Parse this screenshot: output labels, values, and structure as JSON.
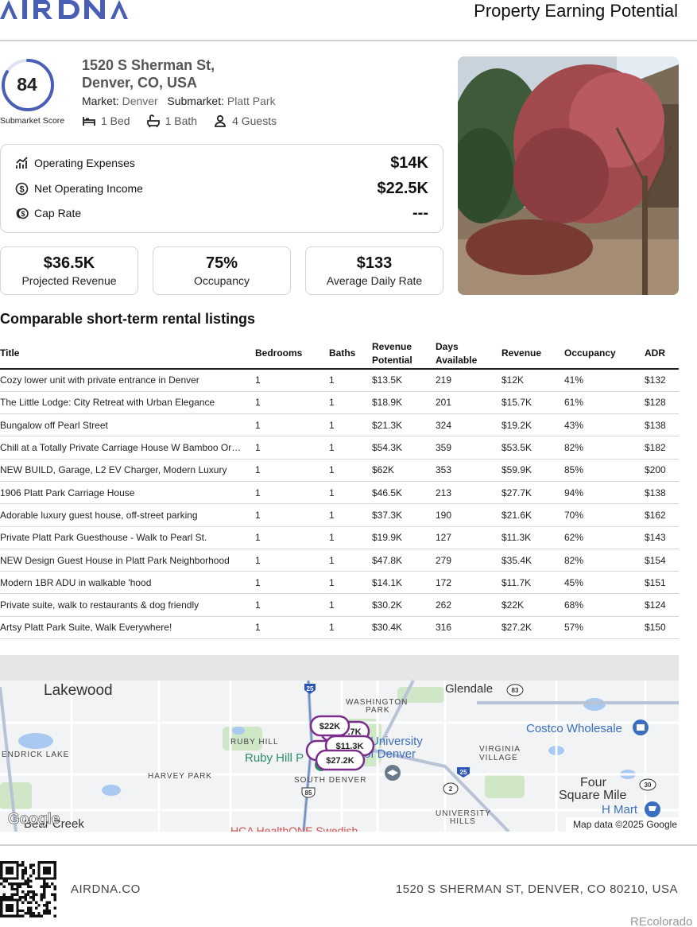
{
  "header": {
    "logo_text": "AIRDNA",
    "title": "Property Earning Potential"
  },
  "score": {
    "value": "84",
    "label": "Submarket Score",
    "fraction": 0.84,
    "color": "#4a5fb4"
  },
  "property": {
    "address_line1": "1520 S Sherman St,",
    "address_line2": "Denver, CO, USA",
    "market_label": "Market:",
    "market_value": "Denver",
    "submarket_label": "Submarket:",
    "submarket_value": "Platt Park",
    "beds": "1 Bed",
    "baths": "1 Bath",
    "guests": "4 Guests"
  },
  "operating": {
    "expenses_label": "Operating Expenses",
    "expenses_value": "$14K",
    "noi_label": "Net Operating Income",
    "noi_value": "$22.5K",
    "cap_label": "Cap Rate",
    "cap_value": "---"
  },
  "metrics": [
    {
      "value": "$36.5K",
      "label": "Projected Revenue"
    },
    {
      "value": "75%",
      "label": "Occupancy"
    },
    {
      "value": "$133",
      "label": "Average Daily Rate"
    }
  ],
  "comparables": {
    "heading": "Comparable short-term rental listings",
    "columns": {
      "title": "Title",
      "bedrooms": "Bedrooms",
      "baths": "Baths",
      "revenue_potential_1": "Revenue",
      "revenue_potential_2": "Potential",
      "days_available_1": "Days",
      "days_available_2": "Available",
      "revenue": "Revenue",
      "occupancy": "Occupancy",
      "adr": "ADR"
    },
    "rows": [
      [
        "Cozy lower unit with private entrance in Denver",
        "1",
        "1",
        "$13.5K",
        "219",
        "$12K",
        "41%",
        "$132"
      ],
      [
        "The Little Lodge: City Retreat with Urban Elegance",
        "1",
        "1",
        "$18.9K",
        "201",
        "$15.7K",
        "61%",
        "$128"
      ],
      [
        "Bungalow off Pearl Street",
        "1",
        "1",
        "$21.3K",
        "324",
        "$19.2K",
        "43%",
        "$138"
      ],
      [
        "Chill at a Totally Private Carriage House W Bamboo Or…",
        "1",
        "1",
        "$54.3K",
        "359",
        "$53.5K",
        "82%",
        "$182"
      ],
      [
        "NEW BUILD, Garage, L2 EV Charger, Modern Luxury",
        "1",
        "1",
        "$62K",
        "353",
        "$59.9K",
        "85%",
        "$200"
      ],
      [
        "1906 Platt Park Carriage House",
        "1",
        "1",
        "$46.5K",
        "213",
        "$27.7K",
        "94%",
        "$138"
      ],
      [
        "Adorable luxury guest house, off-street parking",
        "1",
        "1",
        "$37.3K",
        "190",
        "$21.6K",
        "70%",
        "$162"
      ],
      [
        "Private Platt Park Guesthouse - Walk to Pearl St.",
        "1",
        "1",
        "$19.9K",
        "127",
        "$11.3K",
        "62%",
        "$143"
      ],
      [
        "NEW Design Guest House in Platt Park Neighborhood",
        "1",
        "1",
        "$47.8K",
        "279",
        "$35.4K",
        "82%",
        "$154"
      ],
      [
        "Modern 1BR ADU in walkable 'hood",
        "1",
        "1",
        "$14.1K",
        "172",
        "$11.7K",
        "45%",
        "$151"
      ],
      [
        "Private suite, walk to restaurants & dog friendly",
        "1",
        "1",
        "$30.2K",
        "262",
        "$22K",
        "68%",
        "$124"
      ],
      [
        "Artsy Platt Park Suite, Walk Everywhere!",
        "1",
        "1",
        "$30.4K",
        "316",
        "$27.2K",
        "57%",
        "$150"
      ]
    ]
  },
  "map": {
    "labels": {
      "lakewood": "Lakewood",
      "glendale": "Glendale",
      "washington_park": "WASHINGTON",
      "washington_park2": "PARK",
      "ruby_hill": "RUBY HILL",
      "ruby_hill_park": "Ruby Hill P",
      "university": "University",
      "of_denver": "of Denver",
      "endrick_lake": "ENDRICK LAKE",
      "harvey_park": "HARVEY PARK",
      "south_denver": "SOUTH DENVER",
      "virginia": "VIRGINIA",
      "village": "VILLAGE",
      "costco": "Costco Wholesale",
      "four": "Four",
      "square_mile": "Square Mile",
      "hmart": "H Mart",
      "university_hills": "UNIVERSITY",
      "hills": "HILLS",
      "bear_creek": "Bear Creek",
      "hca": "HCA HealthONE Swedish",
      "google": "Google",
      "attribution": "Map data ©2025 Google"
    },
    "route_shields": [
      "25",
      "83",
      "25",
      "2",
      "30",
      "85"
    ],
    "pins": [
      "$22K",
      "$15.7K",
      "$11.3K",
      "$27.2K"
    ],
    "pin_partial_text": ".7K",
    "pin_color": "#7b2d8b"
  },
  "footer": {
    "site": "AIRDNA.CO",
    "address": "1520 S SHERMAN ST, DENVER, CO 80210, USA",
    "watermark": "REcolorado"
  }
}
